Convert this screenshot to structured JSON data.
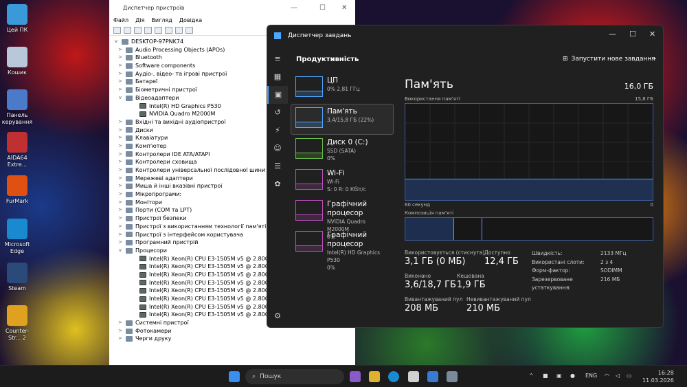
{
  "desktop": {
    "icons": [
      {
        "label": "Цей ПК",
        "color": "#3a9ad9"
      },
      {
        "label": "Кошик",
        "color": "#b8c8d8"
      },
      {
        "label": "Панель керування",
        "color": "#4a7ac9"
      },
      {
        "label": "AIDA64 Extre...",
        "color": "#c03030"
      },
      {
        "label": "FurMark",
        "color": "#e05010"
      },
      {
        "label": "Microsoft Edge",
        "color": "#1a8ad0"
      },
      {
        "label": "Steam",
        "color": "#2a4a7a"
      },
      {
        "label": "Counter-Str... 2",
        "color": "#e0a020"
      }
    ]
  },
  "device_manager": {
    "title": "Диспетчер пристроїв",
    "menu": [
      "Файл",
      "Дія",
      "Вигляд",
      "Довідка"
    ],
    "root": "DESKTOP-97PNK74",
    "items": [
      {
        "label": "Audio Processing Objects (APOs)",
        "level": 1,
        "exp": ">"
      },
      {
        "label": "Bluetooth",
        "level": 1,
        "exp": ">"
      },
      {
        "label": "Software components",
        "level": 1,
        "exp": ">"
      },
      {
        "label": "Аудіо-, відео- та ігрові пристрої",
        "level": 1,
        "exp": ">"
      },
      {
        "label": "Батареї",
        "level": 1,
        "exp": ">"
      },
      {
        "label": "Біометричні пристрої",
        "level": 1,
        "exp": ">"
      },
      {
        "label": "Відеоадаптери",
        "level": 1,
        "exp": "v"
      },
      {
        "label": "Intel(R) HD Graphics P530",
        "level": 2,
        "exp": ""
      },
      {
        "label": "NVIDIA Quadro M2000M",
        "level": 2,
        "exp": ""
      },
      {
        "label": "Вхідні та вихідні аудіопристрої",
        "level": 1,
        "exp": ">"
      },
      {
        "label": "Диски",
        "level": 1,
        "exp": ">"
      },
      {
        "label": "Клавіатури",
        "level": 1,
        "exp": ">"
      },
      {
        "label": "Комп'ютер",
        "level": 1,
        "exp": ">"
      },
      {
        "label": "Контролери IDE ATA/ATAPI",
        "level": 1,
        "exp": ">"
      },
      {
        "label": "Контролери сховища",
        "level": 1,
        "exp": ">"
      },
      {
        "label": "Контролери універсальної послідовної шини",
        "level": 1,
        "exp": ">"
      },
      {
        "label": "Мережеві адаптери",
        "level": 1,
        "exp": ">"
      },
      {
        "label": "Миша й інші вказівні пристрої",
        "level": 1,
        "exp": ">"
      },
      {
        "label": "Мікропрограми:",
        "level": 1,
        "exp": ">"
      },
      {
        "label": "Монітори",
        "level": 1,
        "exp": ">"
      },
      {
        "label": "Порти (COM та LPT)",
        "level": 1,
        "exp": ">"
      },
      {
        "label": "Пристрої безпеки",
        "level": 1,
        "exp": ">"
      },
      {
        "label": "Пристрої з використанням технології пам'яті",
        "level": 1,
        "exp": ">"
      },
      {
        "label": "Пристрої з інтерфейсом користувача",
        "level": 1,
        "exp": ">"
      },
      {
        "label": "Програмний пристрій",
        "level": 1,
        "exp": ">"
      },
      {
        "label": "Процесори",
        "level": 1,
        "exp": "v"
      },
      {
        "label": "Intel(R) Xeon(R) CPU E3-1505M v5 @ 2.80GHz",
        "level": 2,
        "exp": ""
      },
      {
        "label": "Intel(R) Xeon(R) CPU E3-1505M v5 @ 2.80GHz",
        "level": 2,
        "exp": ""
      },
      {
        "label": "Intel(R) Xeon(R) CPU E3-1505M v5 @ 2.80GHz",
        "level": 2,
        "exp": ""
      },
      {
        "label": "Intel(R) Xeon(R) CPU E3-1505M v5 @ 2.80GHz",
        "level": 2,
        "exp": ""
      },
      {
        "label": "Intel(R) Xeon(R) CPU E3-1505M v5 @ 2.80GHz",
        "level": 2,
        "exp": ""
      },
      {
        "label": "Intel(R) Xeon(R) CPU E3-1505M v5 @ 2.80GHz",
        "level": 2,
        "exp": ""
      },
      {
        "label": "Intel(R) Xeon(R) CPU E3-1505M v5 @ 2.80GHz",
        "level": 2,
        "exp": ""
      },
      {
        "label": "Intel(R) Xeon(R) CPU E3-1505M v5 @ 2.80GHz",
        "level": 2,
        "exp": ""
      },
      {
        "label": "Системні пристрої",
        "level": 1,
        "exp": ">"
      },
      {
        "label": "Фотокамери",
        "level": 1,
        "exp": ">"
      },
      {
        "label": "Черги друку",
        "level": 1,
        "exp": ">"
      }
    ]
  },
  "task_manager": {
    "title": "Диспетчер завдань",
    "header": "Продуктивність",
    "new_task": "Запустити нове завдання",
    "list": [
      {
        "name": "ЦП",
        "sub1": "0% 2,81 ГГц",
        "sub2": "",
        "color": "#4ea6ff",
        "selected": false
      },
      {
        "name": "Пам'ять",
        "sub1": "3,4/15,8 ГБ (22%)",
        "sub2": "",
        "color": "#4ea6ff",
        "selected": true
      },
      {
        "name": "Диск 0 (C:)",
        "sub1": "SSD (SATA)",
        "sub2": "0%",
        "color": "#6cc04a",
        "selected": false
      },
      {
        "name": "Wi-Fi",
        "sub1": "Wi-Fi",
        "sub2": "S: 0 R: 0 Кбіт/с",
        "color": "#c050c0",
        "selected": false
      },
      {
        "name": "Графічний процесор",
        "sub1": "NVIDIA Quadro M2000M",
        "sub2": "0%",
        "color": "#c050c0",
        "selected": false
      },
      {
        "name": "Графічний процесор",
        "sub1": "Intel(R) HD Graphics P530",
        "sub2": "0%",
        "color": "#c050c0",
        "selected": false
      }
    ],
    "detail": {
      "title": "Пам'ять",
      "total": "16,0 ГБ",
      "usage_label": "Використання пам'яті",
      "usage_max": "15,8 ГБ",
      "x_left": "60 секунд",
      "x_right": "0",
      "comp_label": "Композиція пам'яті",
      "usage_fraction": 0.22,
      "stats": [
        {
          "label": "Використовується (стиснута)",
          "value": "3,1 ГБ (0 МБ)"
        },
        {
          "label": "Доступно",
          "value": "12,4 ГБ"
        },
        {
          "label": "Виконано",
          "value": "3,6/18,7 ГБ"
        },
        {
          "label": "Кешована",
          "value": "1,9 ГБ"
        },
        {
          "label": "Вивантажуваний пул",
          "value": "208 МБ"
        },
        {
          "label": "Невивантажуваний пул",
          "value": "210 МБ"
        }
      ],
      "kv": [
        {
          "k": "Швидкість:",
          "v": "2133 МГц"
        },
        {
          "k": "Використані слоти:",
          "v": "2 з 4"
        },
        {
          "k": "Форм-фактор:",
          "v": "SODIMM"
        },
        {
          "k": "Зарезервоване устаткування:",
          "v": "216 МБ"
        }
      ]
    }
  },
  "taskbar": {
    "search": "Пошук",
    "lang": "ENG",
    "time": "16:28",
    "date": "11.03.2026"
  }
}
